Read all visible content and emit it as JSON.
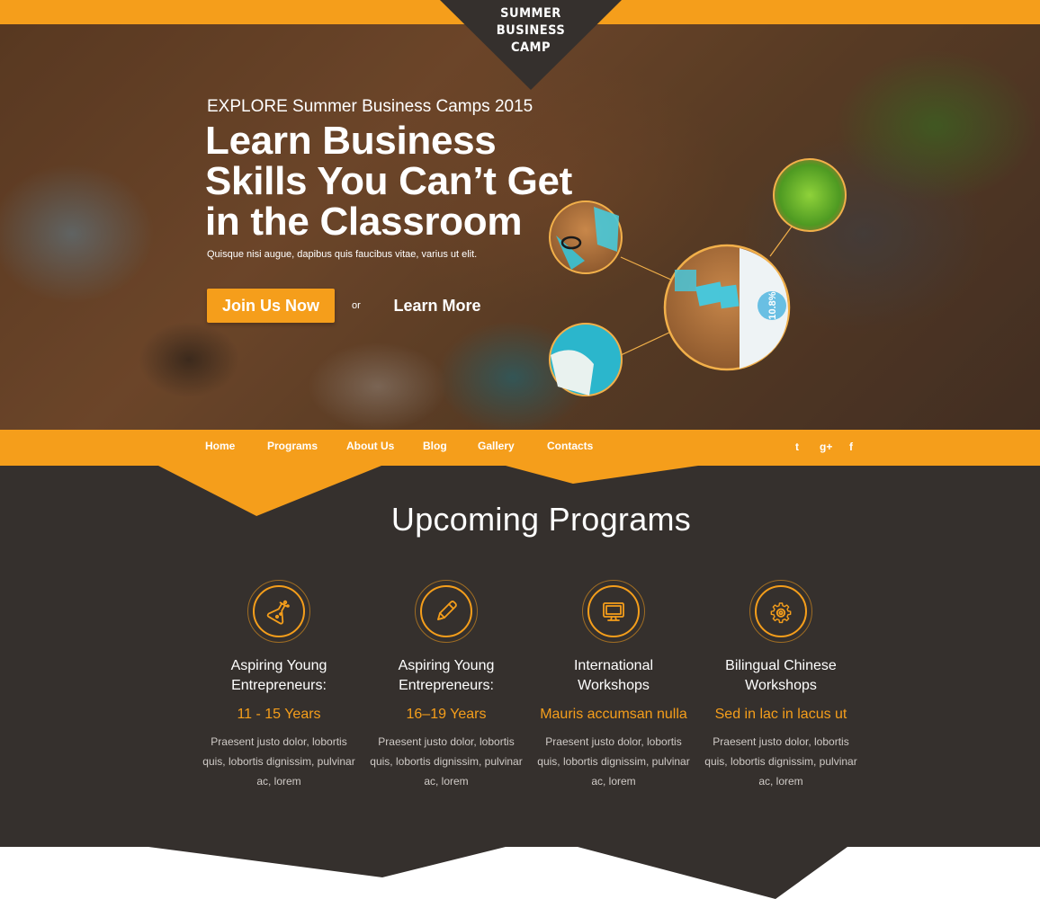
{
  "brand": {
    "logo_text": "SUMMER\nBUSINESS\nCAMP"
  },
  "hero": {
    "eyebrow": "EXPLORE Summer Business Camps 2015",
    "headline": "Learn Business Skills You Can’t Get in the Classroom",
    "subtext": "Quisque nisi augue, dapibus quis faucibus vitae, varius ut elit.",
    "join_label": "Join Us Now",
    "or_label": "or",
    "learn_label": "Learn More",
    "badge_value": "10.8%"
  },
  "nav": {
    "items": [
      "Home",
      "Programs",
      "About Us",
      "Blog",
      "Gallery",
      "Contacts"
    ],
    "social_icons": [
      "twitter-icon",
      "google-plus-icon",
      "facebook-icon"
    ],
    "social_glyphs": [
      "t",
      "g+",
      "f"
    ]
  },
  "programs": {
    "title": "Upcoming Programs",
    "cards": [
      {
        "icon": "flask-icon",
        "title": "Aspiring Young\nEntrepreneurs:",
        "subtitle": "11 - 15 Years",
        "description": "Praesent justo dolor, lobortis quis, lobortis dignissim, pulvinar ac, lorem"
      },
      {
        "icon": "pencil-icon",
        "title": "Aspiring Young\nEntrepreneurs:",
        "subtitle": "16–19 Years",
        "description": "Praesent justo dolor, lobortis quis, lobortis dignissim, pulvinar ac, lorem"
      },
      {
        "icon": "monitor-icon",
        "title": "International\nWorkshops",
        "subtitle": "Mauris accumsan nulla",
        "description": "Praesent justo dolor, lobortis quis, lobortis dignissim, pulvinar ac, lorem"
      },
      {
        "icon": "gear-icon",
        "title": "Bilingual Chinese\nWorkshops",
        "subtitle": "Sed in lac in lacus ut",
        "description": "Praesent justo dolor, lobortis quis, lobortis dignissim, pulvinar ac, lorem"
      }
    ]
  },
  "colors": {
    "accent": "#f59e1b",
    "dark": "#35302d",
    "light_text": "#cfcac6"
  }
}
